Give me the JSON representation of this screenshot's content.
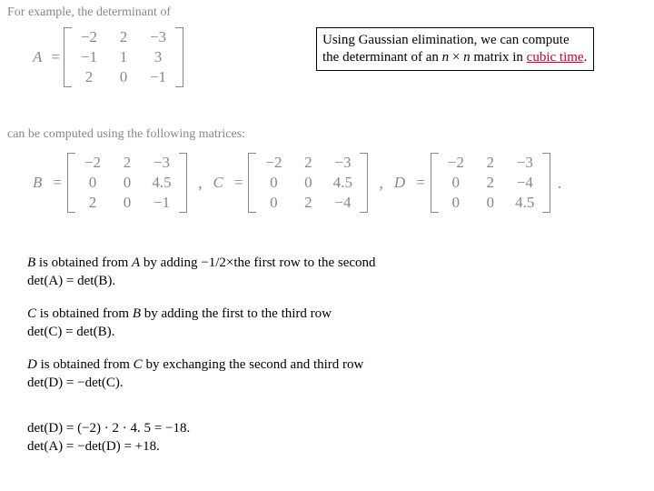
{
  "intro": "For example, the determinant of",
  "A": {
    "name": "A",
    "rows": [
      [
        "−2",
        "2",
        "−3"
      ],
      [
        "−1",
        "1",
        "3"
      ],
      [
        "2",
        "0",
        "−1"
      ]
    ]
  },
  "note": {
    "line1a": "Using Gaussian elimination, we can compute the determinant of an ",
    "nxn1": "n",
    "times": " × ",
    "nxn2": "n",
    "line1b": " matrix in ",
    "cubic": "cubic time",
    "period": "."
  },
  "sub_intro": "can be computed using the following matrices:",
  "B": {
    "name": "B",
    "rows": [
      [
        "−2",
        "2",
        "−3"
      ],
      [
        "0",
        "0",
        "4.5"
      ],
      [
        "2",
        "0",
        "−1"
      ]
    ]
  },
  "C": {
    "name": "C",
    "rows": [
      [
        "−2",
        "2",
        "−3"
      ],
      [
        "0",
        "0",
        "4.5"
      ],
      [
        "0",
        "2",
        "−4"
      ]
    ]
  },
  "D": {
    "name": "D",
    "rows": [
      [
        "−2",
        "2",
        "−3"
      ],
      [
        "0",
        "2",
        "−4"
      ],
      [
        "0",
        "0",
        "4.5"
      ]
    ]
  },
  "e1": {
    "text_a": " is obtained from ",
    "B": "B",
    "A": "A",
    "text_b": " by adding −1/2×the first row to the second",
    "det": "det(A) = det(B)."
  },
  "e2": {
    "C": "C",
    "B": "B",
    "text_a": " is obtained from ",
    "text_b": " by adding the first to the third row",
    "det": "det(C) = det(B)."
  },
  "e3": {
    "D": "D",
    "C": "C",
    "text_a": " is obtained from ",
    "text_b": " by exchanging the second and third row",
    "det": "det(D) = −det(C)."
  },
  "e4": {
    "line1": "det(D) = (−2) · 2 · 4. 5 = −18.",
    "line2": "det(A) = −det(D) = +18."
  }
}
